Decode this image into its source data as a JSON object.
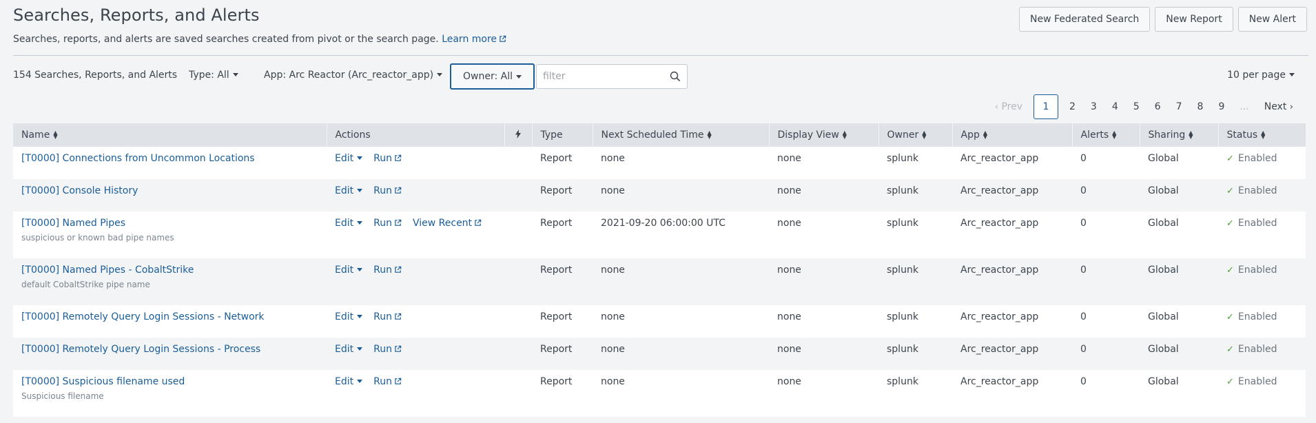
{
  "header": {
    "title": "Searches, Reports, and Alerts",
    "description": "Searches, reports, and alerts are saved searches created from pivot or the search page.",
    "learn_more": "Learn more"
  },
  "buttons": {
    "new_federated": "New Federated Search",
    "new_report": "New Report",
    "new_alert": "New Alert"
  },
  "toolbar": {
    "count": "154 Searches, Reports, and Alerts",
    "type": "Type: All",
    "app": "App: Arc Reactor (Arc_reactor_app)",
    "owner": "Owner: All",
    "filter_placeholder": "filter",
    "per_page": "10 per page"
  },
  "pagination": {
    "prev": "Prev",
    "pages": [
      "1",
      "2",
      "3",
      "4",
      "5",
      "6",
      "7",
      "8",
      "9"
    ],
    "ellipsis": "...",
    "next": "Next"
  },
  "columns": {
    "name": "Name",
    "actions": "Actions",
    "type": "Type",
    "next_scheduled": "Next Scheduled Time",
    "display_view": "Display View",
    "owner": "Owner",
    "app": "App",
    "alerts": "Alerts",
    "sharing": "Sharing",
    "status": "Status"
  },
  "action_labels": {
    "edit": "Edit",
    "run": "Run",
    "view_recent": "View Recent"
  },
  "rows": [
    {
      "name": "[T0000] Connections from Uncommon Locations",
      "desc": "",
      "type": "Report",
      "next": "none",
      "view": "none",
      "owner": "splunk",
      "app": "Arc_reactor_app",
      "alerts": "0",
      "sharing": "Global",
      "status": "Enabled"
    },
    {
      "name": "[T0000] Console History",
      "desc": "",
      "type": "Report",
      "next": "none",
      "view": "none",
      "owner": "splunk",
      "app": "Arc_reactor_app",
      "alerts": "0",
      "sharing": "Global",
      "status": "Enabled"
    },
    {
      "name": "[T0000] Named Pipes",
      "desc": "suspicious or known bad pipe names",
      "type": "Report",
      "next": "2021-09-20 06:00:00 UTC",
      "view": "none",
      "owner": "splunk",
      "app": "Arc_reactor_app",
      "alerts": "0",
      "sharing": "Global",
      "status": "Enabled"
    },
    {
      "name": "[T0000] Named Pipes - CobaltStrike",
      "desc": "default CobaltStrike pipe name",
      "type": "Report",
      "next": "none",
      "view": "none",
      "owner": "splunk",
      "app": "Arc_reactor_app",
      "alerts": "0",
      "sharing": "Global",
      "status": "Enabled"
    },
    {
      "name": "[T0000] Remotely Query Login Sessions - Network",
      "desc": "",
      "type": "Report",
      "next": "none",
      "view": "none",
      "owner": "splunk",
      "app": "Arc_reactor_app",
      "alerts": "0",
      "sharing": "Global",
      "status": "Enabled"
    },
    {
      "name": "[T0000] Remotely Query Login Sessions - Process",
      "desc": "",
      "type": "Report",
      "next": "none",
      "view": "none",
      "owner": "splunk",
      "app": "Arc_reactor_app",
      "alerts": "0",
      "sharing": "Global",
      "status": "Enabled"
    },
    {
      "name": "[T0000] Suspicious filename used",
      "desc": "Suspicious filename",
      "type": "Report",
      "next": "none",
      "view": "none",
      "owner": "splunk",
      "app": "Arc_reactor_app",
      "alerts": "0",
      "sharing": "Global",
      "status": "Enabled"
    }
  ]
}
